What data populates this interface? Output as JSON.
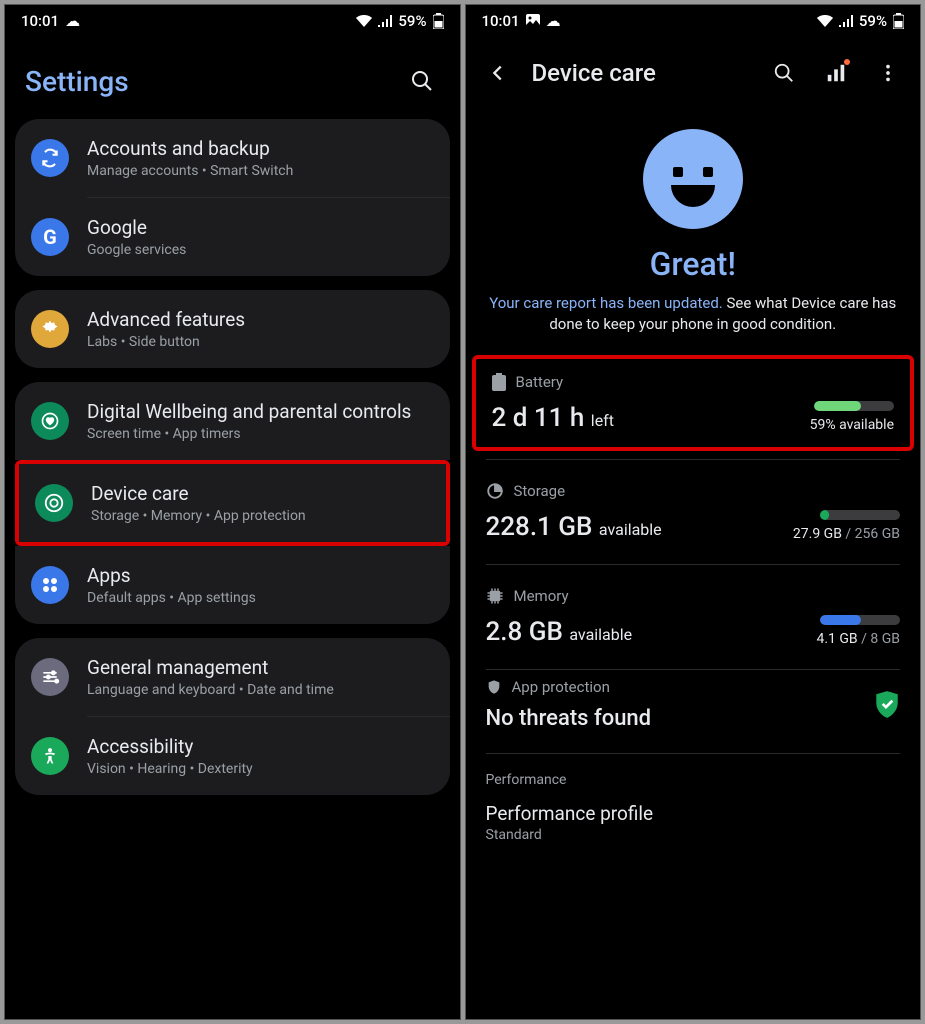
{
  "status": {
    "time": "10:01",
    "battery": "59%"
  },
  "left": {
    "title": "Settings",
    "groups": [
      {
        "items": [
          {
            "icon": "sync",
            "bg": "#3a77e8",
            "title": "Accounts and backup",
            "sub": "Manage accounts  •  Smart Switch"
          },
          {
            "icon": "G",
            "bg": "#3a77e8",
            "title": "Google",
            "sub": "Google services"
          }
        ]
      },
      {
        "items": [
          {
            "icon": "gear",
            "bg": "#e0a73a",
            "title": "Advanced features",
            "sub": "Labs  •  Side button"
          }
        ]
      },
      {
        "items": [
          {
            "icon": "heart",
            "bg": "#0d8a5a",
            "title": "Digital Wellbeing and parental controls",
            "sub": "Screen time  •  App timers"
          },
          {
            "icon": "care",
            "bg": "#0d8a5a",
            "title": "Device care",
            "sub": "Storage  •  Memory  •  App protection",
            "highlight": true
          },
          {
            "icon": "apps",
            "bg": "#3a77e8",
            "title": "Apps",
            "sub": "Default apps  •  App settings"
          }
        ]
      },
      {
        "items": [
          {
            "icon": "sliders",
            "bg": "#6b6b7d",
            "title": "General management",
            "sub": "Language and keyboard  •  Date and time"
          },
          {
            "icon": "access",
            "bg": "#1aa85a",
            "title": "Accessibility",
            "sub": "Vision  •  Hearing  •  Dexterity"
          }
        ]
      }
    ]
  },
  "right": {
    "title": "Device care",
    "status_title": "Great!",
    "report_updated": "Your care report has been updated.",
    "report_rest": " See what Device care has done to keep your phone in good condition.",
    "stats": {
      "battery": {
        "label": "Battery",
        "main": "2 d 11 h",
        "suffix": "left",
        "avail": "59% available",
        "pct": 59,
        "color": "#6fd67a",
        "highlight": true
      },
      "storage": {
        "label": "Storage",
        "main": "228.1 GB",
        "suffix": "available",
        "used": "27.9 GB",
        "total": "256 GB",
        "pct": 11,
        "color": "#1aa85a"
      },
      "memory": {
        "label": "Memory",
        "main": "2.8 GB",
        "suffix": "available",
        "used": "4.1 GB",
        "total": "8 GB",
        "pct": 51,
        "color": "#3a77e8"
      }
    },
    "app_protection": {
      "label": "App protection",
      "status": "No threats found"
    },
    "performance": {
      "section": "Performance",
      "title": "Performance profile",
      "value": "Standard"
    }
  }
}
